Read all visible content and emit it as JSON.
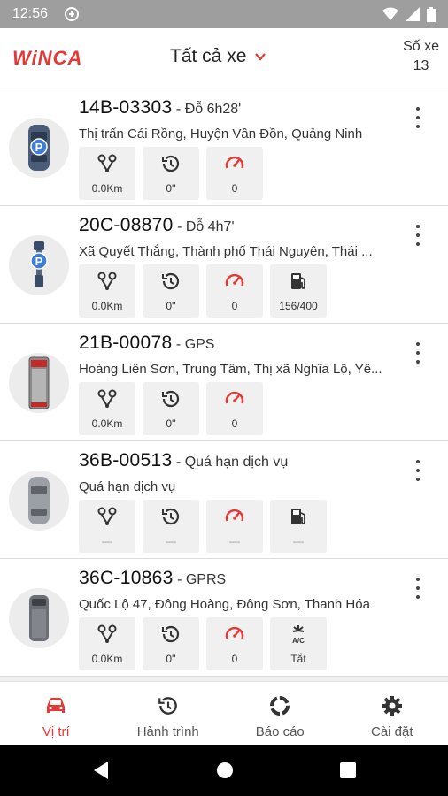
{
  "statusbar": {
    "time": "12:56"
  },
  "header": {
    "logo_text": "WiNCA",
    "title": "Tất cả xe",
    "count_label": "Số xe",
    "count_value": "13"
  },
  "colors": {
    "accent": "#e53935",
    "speed_icon": "#e53935",
    "tile_bg": "#f0f0f0"
  },
  "vehicles": [
    {
      "plate": "14B-03303",
      "status": " - Đỗ 6h28'",
      "address": "Thị trấn Cái Rồng, Huyện Vân Đồn, Quảng Ninh",
      "icon": "parked-car-icon",
      "metrics": [
        {
          "icon": "distance-icon",
          "value": "0.0Km"
        },
        {
          "icon": "history-icon",
          "value": "0''"
        },
        {
          "icon": "speedometer-icon",
          "value": "0"
        }
      ]
    },
    {
      "plate": "20C-08870",
      "status": " - Đỗ 4h7'",
      "address": "Xã Quyết Thắng, Thành phố Thái Nguyên, Thái ...",
      "icon": "parked-truck-icon",
      "metrics": [
        {
          "icon": "distance-icon",
          "value": "0.0Km"
        },
        {
          "icon": "history-icon",
          "value": "0''"
        },
        {
          "icon": "speedometer-icon",
          "value": "0"
        },
        {
          "icon": "fuel-icon",
          "value": "156/400"
        }
      ]
    },
    {
      "plate": "21B-00078",
      "status": " - GPS",
      "address": "Hoàng Liên Sơn, Trung Tâm, Thị xã Nghĩa Lộ, Yê...",
      "icon": "bus-icon",
      "metrics": [
        {
          "icon": "distance-icon",
          "value": "0.0Km"
        },
        {
          "icon": "history-icon",
          "value": "0''"
        },
        {
          "icon": "speedometer-icon",
          "value": "0"
        }
      ]
    },
    {
      "plate": "36B-00513",
      "status": " - Quá hạn dịch vụ",
      "address": "Quá hạn dịch vụ",
      "icon": "car-icon",
      "metrics": [
        {
          "icon": "distance-icon",
          "value": "—"
        },
        {
          "icon": "history-icon",
          "value": "—"
        },
        {
          "icon": "speedometer-icon",
          "value": "—"
        },
        {
          "icon": "fuel-icon",
          "value": "—"
        }
      ]
    },
    {
      "plate": "36C-10863",
      "status": " - GPRS",
      "address": "Quốc Lộ 47, Đông Hoàng, Đông Sơn, Thanh Hóa",
      "icon": "van-icon",
      "metrics": [
        {
          "icon": "distance-icon",
          "value": "0.0Km"
        },
        {
          "icon": "history-icon",
          "value": "0''"
        },
        {
          "icon": "speedometer-icon",
          "value": "0"
        },
        {
          "icon": "ac-icon",
          "value": "Tắt"
        }
      ]
    }
  ],
  "bottom_nav": [
    {
      "label": "Vị trí",
      "icon": "car-icon",
      "active": true
    },
    {
      "label": "Hành trình",
      "icon": "history-icon",
      "active": false
    },
    {
      "label": "Báo cáo",
      "icon": "report-icon",
      "active": false
    },
    {
      "label": "Cài đặt",
      "icon": "gear-icon",
      "active": false
    }
  ]
}
